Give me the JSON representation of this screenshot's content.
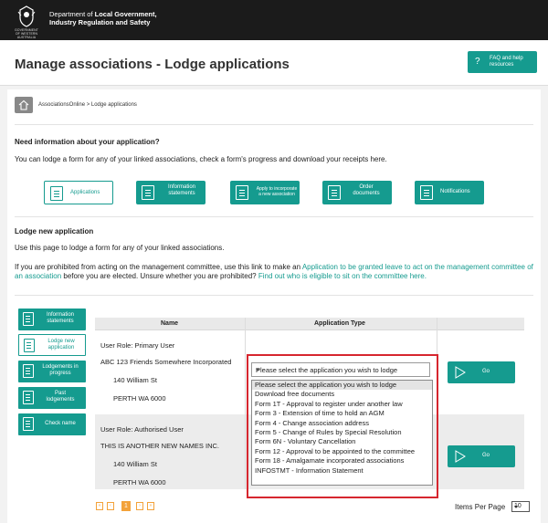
{
  "header": {
    "crest_text": "GOVERNMENT OF WESTERN AUSTRALIA",
    "dept_line1_prefix": "Department of ",
    "dept_line1_bold": "Local Government,",
    "dept_line2": "Industry Regulation and Safety"
  },
  "title": "Manage associations - Lodge applications",
  "faq_label": "FAQ and help resources",
  "breadcrumb": "AssociationsOnline > Lodge applications",
  "need_info": {
    "title": "Need information about your application?",
    "text": "You can lodge a form for any of your linked associations, check a form's progress and download your receipts here."
  },
  "quick_links": [
    {
      "label": "Applications"
    },
    {
      "label": "Information statements"
    },
    {
      "label": "Apply to incorporate a new association"
    },
    {
      "label": "Order documents"
    },
    {
      "label": "Notifications"
    }
  ],
  "lodge_new": {
    "title": "Lodge new application",
    "text": "Use this page to lodge a form for any of your linked associations.",
    "prohibited_prefix": "If you are prohibited from acting on the management committee, use this link to make an ",
    "prohibited_link": "Application to be granted leave to act on the management committee of an association",
    "prohibited_mid": " before you are elected. Unsure whether you are prohibited? ",
    "prohibited_link2": "Find out who is eligible to sit on the committee here."
  },
  "sidebar": [
    {
      "label": "Information statements"
    },
    {
      "label": "Lodge new application"
    },
    {
      "label": "Lodgements in progress"
    },
    {
      "label": "Past lodgements"
    },
    {
      "label": "Check name"
    }
  ],
  "table": {
    "headers": {
      "name": "Name",
      "type": "Application Type"
    },
    "rows": [
      {
        "role": "User Role: Primary User",
        "assoc": "ABC 123 Friends Somewhere Incorporated",
        "addr1": "140 William St",
        "addr2": "PERTH WA 6000",
        "go": "Go"
      },
      {
        "role": "User Role: Authorised User",
        "assoc": "THIS IS ANOTHER NEW NAMES INC.",
        "addr1": "140 William St",
        "addr2": "PERTH WA 6000",
        "go": "Go"
      }
    ]
  },
  "select": {
    "value": "Please select the application you wish to lodge",
    "options": [
      "Please select the application you wish to lodge",
      "Download free documents",
      "Form 1T - Approval to register under another law",
      "Form 3 - Extension of time to hold an AGM",
      "Form 4 - Change association address",
      "Form 5 - Change of Rules by Special Resolution",
      "Form 6N - Voluntary Cancellation",
      "Form 12 - Approval to be appointed to the committee",
      "Form 18 - Amalgamate incorporated associations",
      "INFOSTMT - Information Statement"
    ]
  },
  "pager": {
    "current": "1",
    "first": "«",
    "prev": "‹",
    "next": "›",
    "last": "»"
  },
  "items_per_page": {
    "label": "Items Per Page",
    "value": "10"
  },
  "colors": {
    "accent": "#159b8f",
    "highlight": "#d6262e",
    "pager": "#f3a23a"
  }
}
